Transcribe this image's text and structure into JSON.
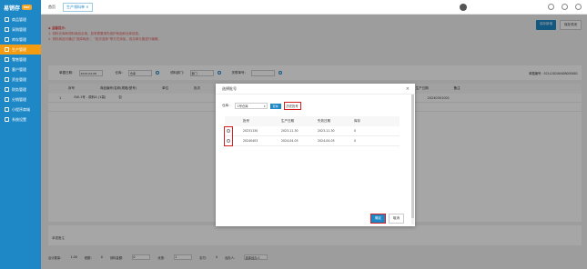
{
  "sidebar": {
    "logo": "易销存",
    "badge": "ERP",
    "items": [
      {
        "label": "商品管理",
        "icon": "box-icon",
        "active": false
      },
      {
        "label": "采购管理",
        "icon": "cart-icon",
        "active": false
      },
      {
        "label": "库存管理",
        "icon": "warehouse-icon",
        "active": false
      },
      {
        "label": "生产管理",
        "icon": "factory-icon",
        "active": true
      },
      {
        "label": "零售管理",
        "icon": "store-icon",
        "active": false
      },
      {
        "label": "客户管理",
        "icon": "user-icon",
        "active": false
      },
      {
        "label": "资金管理",
        "icon": "money-icon",
        "active": false
      },
      {
        "label": "财务管理",
        "icon": "finance-icon",
        "active": false
      },
      {
        "label": "分销管理",
        "icon": "share-icon",
        "active": false
      },
      {
        "label": "小程序商城",
        "icon": "mini-icon",
        "active": false
      },
      {
        "label": "系统设置",
        "icon": "gear-icon",
        "active": false
      }
    ]
  },
  "top": {
    "tabs": [
      {
        "label": "首页",
        "active": false
      },
      {
        "label": "生产领料单 ×",
        "active": true
      }
    ]
  },
  "actions": {
    "btn1": "保存新增",
    "btn2": "保存关闭"
  },
  "tips": {
    "head": "◆ 温馨提示：",
    "line1": "1. 领料仓库和领料商品必填，如有需要请先维护商品和仓库信息。",
    "line2": "2. 领料商品可通过“选择商品”、“批次选择”等方式添加，双击单元格进行编辑。"
  },
  "search": {
    "date_label": "单据日期：",
    "date_value": "2024-04-08",
    "warehouse_label": "仓库：",
    "warehouse_value": "仓库",
    "dept_label": "领料部门：",
    "dept_value": "部门",
    "related_label": "关联单号：",
    "bill_no": "单据编号：SCLL20240408000001"
  },
  "table": {
    "headers": [
      "序号",
      "商品编号/名称(规格/型号)",
      "单位",
      "批次",
      "数量",
      "单价",
      "金额",
      "批次号",
      "生产日期",
      "备注"
    ],
    "rows": [
      {
        "idx": "1",
        "name": "SW-1号 - 原料A (1袋)",
        "unit": "包",
        "qty": "1.00",
        "batch": "20240301001"
      }
    ]
  },
  "remark_label": "单据备注",
  "footer": {
    "total_label": "合计数量：",
    "total_value": "1.00",
    "tax_label": "税额：",
    "tax_value": "0",
    "amount_label": "领料金额：",
    "amount_value": "0",
    "discount_label": "优惠：",
    "discount_value": "1",
    "paid_label": "实付：",
    "paid_value": "0",
    "handler_label": "经办人：",
    "handler_value": "选择经办人"
  },
  "modal": {
    "title": "选择批号",
    "warehouse_label": "仓库：",
    "warehouse_value": "1号仓库",
    "query_btn": "查询",
    "highlight_btn": "历史批号",
    "headers": [
      "",
      "批号",
      "生产日期",
      "失效日期",
      "库存"
    ],
    "rows": [
      {
        "batch": "20231130",
        "mfg": "2023-11-30",
        "exp": "2023-11-30",
        "stock": "0"
      },
      {
        "batch": "20240403",
        "mfg": "2024-04-03",
        "exp": "2024-04-03",
        "stock": "0"
      }
    ],
    "confirm": "确定",
    "cancel": "取消"
  }
}
